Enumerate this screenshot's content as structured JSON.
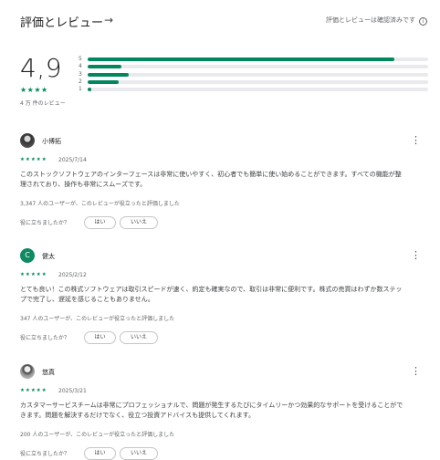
{
  "header": {
    "title": "評価とレビュー",
    "verified_text": "評価とレビューは確認済みです",
    "arrow_icon": "arrow-right-icon",
    "info_icon": "info-icon"
  },
  "summary": {
    "score": "4,9",
    "stars": "★★★★",
    "review_count": "4 万 件のレビュー",
    "accent_color": "#01875f",
    "distribution": [
      {
        "label": "5",
        "fraction": 0.9
      },
      {
        "label": "4",
        "fraction": 0.1
      },
      {
        "label": "3",
        "fraction": 0.12
      },
      {
        "label": "2",
        "fraction": 0.09
      },
      {
        "label": "1",
        "fraction": 0.01
      }
    ]
  },
  "reviews": [
    {
      "name": "小博拓",
      "stars": "★★★★★",
      "date": "2025/7/14",
      "text": "このストックソフトウェアのインターフェースは非常に使いやすく、初心者でも簡単に使い始めることができます。すべての機能が整理されており、操作も非常にスムーズです。",
      "helpful_count": "3,347 人のユーザーが、このレビューが役立ったと評価しました",
      "helpful_question": "役に立ちましたか？",
      "yes": "はい",
      "no": "いいえ"
    },
    {
      "name": "健太",
      "avatar_letter": "C",
      "stars": "★★★★★",
      "date": "2025/2/12",
      "text": "とても良い！この株式ソフトウェアは取引スピードが速く、約定も確実なので、取引は非常に便利です。株式の売買はわずか数ステップで完了し、遅延を感じることもありません。",
      "helpful_count": "347 人のユーザーが、このレビューが役立ったと評価しました",
      "helpful_question": "役に立ちましたか？",
      "yes": "はい",
      "no": "いいえ"
    },
    {
      "name": "悠真",
      "stars": "★★★★★",
      "date": "2025/3/21",
      "text": "カスタマーサービスチームは非常にプロフェッショナルで、問題が発生するたびにタイムリーかつ効果的なサポートを受けることができます。問題を解決するだけでなく、役立つ投資アドバイスも提供してくれます。",
      "helpful_count": "200 人のユーザーが、このレビューが役立ったと評価しました",
      "helpful_question": "役に立ちましたか？",
      "yes": "はい",
      "no": "いいえ"
    }
  ]
}
